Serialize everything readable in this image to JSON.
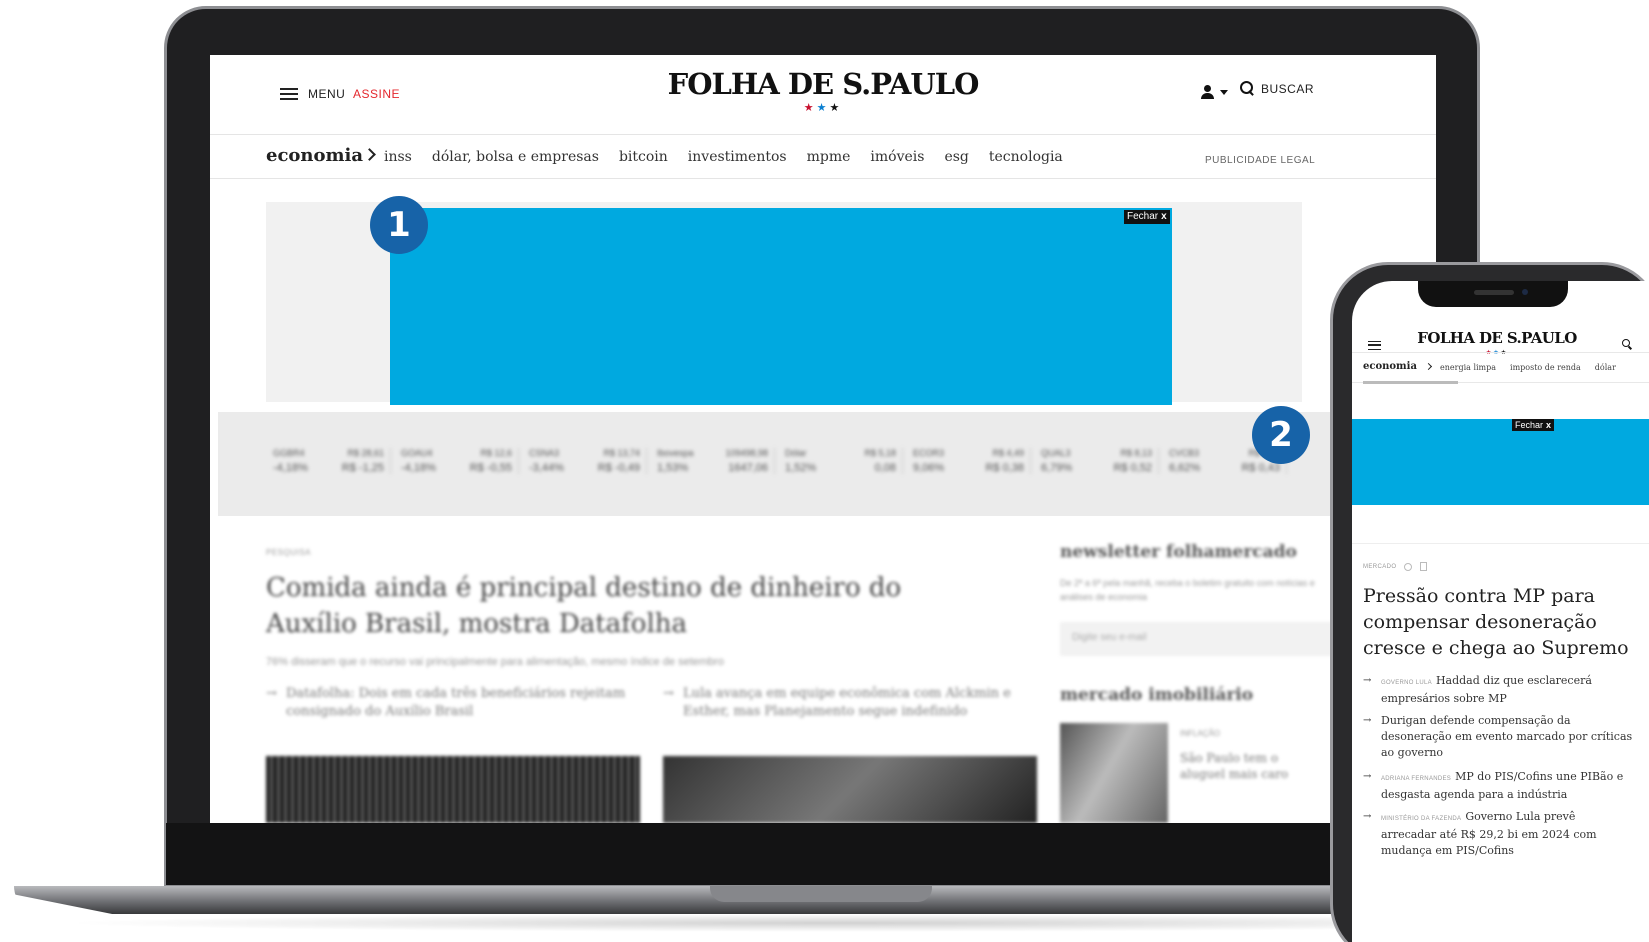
{
  "desktop": {
    "header": {
      "menu_label": "MENU",
      "assine_label": "ASSINE",
      "logo_text": "FOLHA DE S.PAULO",
      "stars": [
        "★",
        "★",
        "★"
      ],
      "buscar_label": "BUSCAR"
    },
    "nav": {
      "section": "economia",
      "links": [
        "inss",
        "dólar, bolsa e empresas",
        "bitcoin",
        "investimentos",
        "mpme",
        "imóveis",
        "esg",
        "tecnologia"
      ],
      "publicidade_legal": "PUBLICIDADE LEGAL"
    },
    "ad": {
      "close_label": "Fechar",
      "close_x": "x",
      "color": "#00a9e0"
    },
    "ticker": [
      {
        "name": "GGBR4",
        "price": "R$ 28,61",
        "pct": "-4,18%",
        "chg": "R$ -1,25"
      },
      {
        "name": "GOAU4",
        "price": "R$ 12,6",
        "pct": "-4,18%",
        "chg": "R$ -0,55"
      },
      {
        "name": "CSNA3",
        "price": "R$ 13,74",
        "pct": "-3,44%",
        "chg": "R$ -0,49"
      },
      {
        "name": "Ibovespa",
        "price": "109498,98",
        "pct": "1,53%",
        "chg": "1647,06"
      },
      {
        "name": "Dólar",
        "price": "R$ 5,18",
        "pct": "1,52%",
        "chg": "0,08"
      },
      {
        "name": "ECOR3",
        "price": "R$ 4,49",
        "pct": "9,06%",
        "chg": "R$ 0,38"
      },
      {
        "name": "QUAL3",
        "price": "R$ 8,13",
        "pct": "6,79%",
        "chg": "R$ 0,52"
      },
      {
        "name": "CVCB3",
        "price": "R$ 6,92",
        "pct": "6,62%",
        "chg": "R$ 0,43"
      }
    ],
    "article": {
      "kicker": "PESQUISA",
      "headline": "Comida ainda é principal destino de dinheiro do Auxílio Brasil, mostra Datafolha",
      "subline": "76% disseram que o recurso vai principalmente para alimentação, mesmo índice de setembro",
      "related": [
        "Datafolha: Dois em cada três beneficiários rejeitam consignado do Auxílio Brasil",
        "Lula avança em equipe econômica com Alckmin e Esther, mas Planejamento segue indefinido"
      ]
    },
    "sidebar": {
      "newsletter_title": "newsletter folhamercado",
      "newsletter_desc": "De 2ª a 6ª pela manhã, receba o boletim gratuito com notícias e análises de economia",
      "email_placeholder": "Digite seu e-mail",
      "section2_title": "mercado imobiliário",
      "item_kicker": "INFLAÇÃO",
      "item_headline": "São Paulo tem o aluguel mais caro"
    },
    "badge": "1"
  },
  "mobile": {
    "logo_text": "FOLHA DE S.PAULO",
    "stars": [
      "★",
      "★",
      "★"
    ],
    "nav": {
      "section": "economia",
      "links": [
        "energia limpa",
        "imposto de renda",
        "dólar"
      ]
    },
    "ad": {
      "close_label": "Fechar",
      "close_x": "x"
    },
    "article": {
      "kicker": "MERCADO",
      "headline": "Pressão contra MP para compensar desoneração cresce e chega ao Supremo",
      "related": [
        {
          "kicker": "GOVERNO LULA",
          "text": "Haddad diz que esclarecerá empresários sobre MP"
        },
        {
          "kicker": "",
          "text": "Durigan defende compensação da desoneração em evento marcado por críticas ao governo"
        },
        {
          "kicker": "ADRIANA FERNANDES",
          "text": "MP do PIS/Cofins une PIBão e desgasta agenda para a indústria"
        },
        {
          "kicker": "MINISTÉRIO DA FAZENDA",
          "text": "Governo Lula prevê arrecadar até R$ 29,2 bi em 2024 com mudança em PIS/Cofins"
        }
      ]
    },
    "badge": "2"
  }
}
